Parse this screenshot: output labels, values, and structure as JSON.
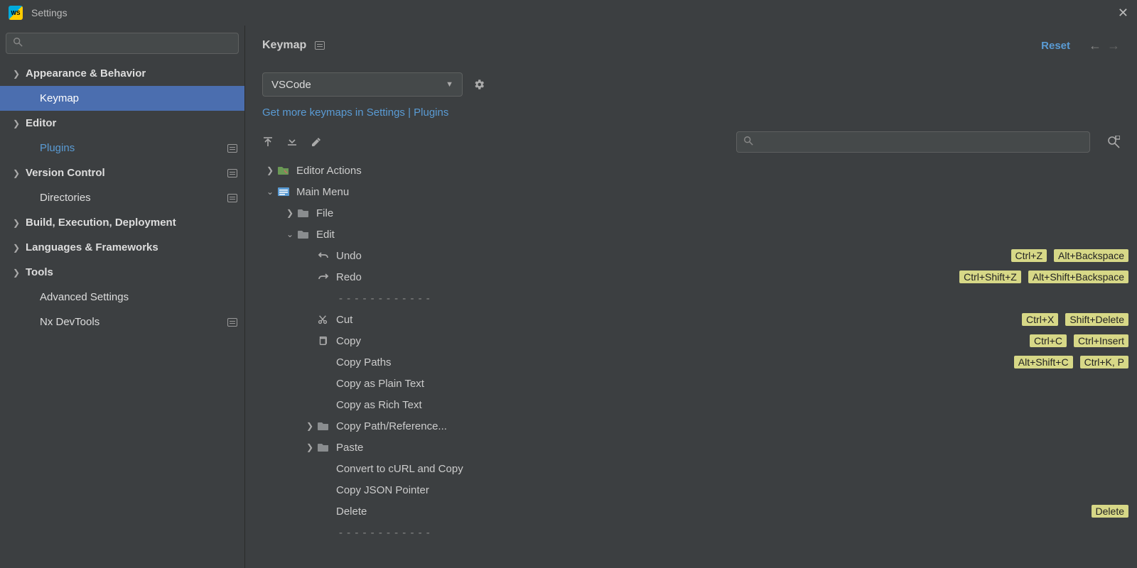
{
  "window": {
    "title": "Settings"
  },
  "sidebar": {
    "search_placeholder": "",
    "items": [
      {
        "label": "Appearance & Behavior",
        "expandable": true,
        "selected": false
      },
      {
        "label": "Keymap",
        "sub": true,
        "selected": true
      },
      {
        "label": "Editor",
        "expandable": true
      },
      {
        "label": "Plugins",
        "sub": true,
        "link": true,
        "badge": true
      },
      {
        "label": "Version Control",
        "expandable": true,
        "badge": true
      },
      {
        "label": "Directories",
        "sub": true,
        "badge": true
      },
      {
        "label": "Build, Execution, Deployment",
        "expandable": true
      },
      {
        "label": "Languages & Frameworks",
        "expandable": true
      },
      {
        "label": "Tools",
        "expandable": true
      },
      {
        "label": "Advanced Settings",
        "sub": true
      },
      {
        "label": "Nx DevTools",
        "sub": true,
        "badge": true
      }
    ]
  },
  "header": {
    "breadcrumb": "Keymap",
    "reset": "Reset"
  },
  "controls": {
    "scheme": "VSCode",
    "more_keymaps": "Get more keymaps in Settings | Plugins"
  },
  "tree": [
    {
      "indent": 0,
      "chev": "right",
      "icon": "actions",
      "label": "Editor Actions"
    },
    {
      "indent": 0,
      "chev": "down",
      "icon": "menu",
      "label": "Main Menu"
    },
    {
      "indent": 1,
      "chev": "right",
      "icon": "folder",
      "label": "File"
    },
    {
      "indent": 1,
      "chev": "down",
      "icon": "folder",
      "label": "Edit"
    },
    {
      "indent": 2,
      "icon": "undo",
      "label": "Undo",
      "shortcuts": [
        "Ctrl+Z",
        "Alt+Backspace"
      ]
    },
    {
      "indent": 2,
      "icon": "redo",
      "label": "Redo",
      "shortcuts": [
        "Ctrl+Shift+Z",
        "Alt+Shift+Backspace"
      ]
    },
    {
      "indent": 2,
      "separator": true
    },
    {
      "indent": 2,
      "icon": "cut",
      "label": "Cut",
      "shortcuts": [
        "Ctrl+X",
        "Shift+Delete"
      ]
    },
    {
      "indent": 2,
      "icon": "copy",
      "label": "Copy",
      "shortcuts": [
        "Ctrl+C",
        "Ctrl+Insert"
      ]
    },
    {
      "indent": 2,
      "label": "Copy Paths",
      "shortcuts": [
        "Alt+Shift+C",
        "Ctrl+K, P"
      ]
    },
    {
      "indent": 2,
      "label": "Copy as Plain Text"
    },
    {
      "indent": 2,
      "label": "Copy as Rich Text"
    },
    {
      "indent": 2,
      "chev": "right",
      "icon": "folder",
      "label": "Copy Path/Reference..."
    },
    {
      "indent": 2,
      "chev": "right",
      "icon": "folder",
      "label": "Paste"
    },
    {
      "indent": 2,
      "label": "Convert to cURL and Copy"
    },
    {
      "indent": 2,
      "label": "Copy JSON Pointer"
    },
    {
      "indent": 2,
      "label": "Delete",
      "shortcuts": [
        "Delete"
      ]
    },
    {
      "indent": 2,
      "separator": true
    }
  ]
}
